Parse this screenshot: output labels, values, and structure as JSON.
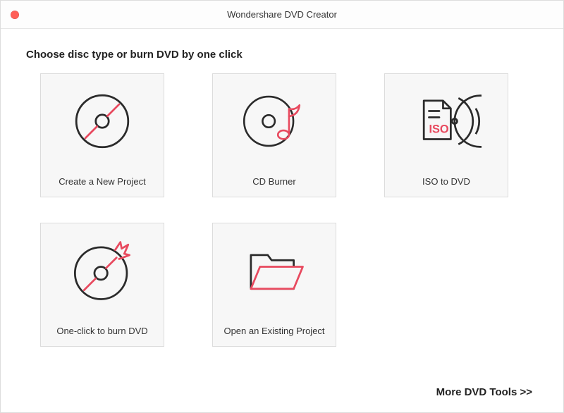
{
  "window": {
    "title": "Wondershare DVD Creator"
  },
  "heading": "Choose disc type or burn DVD by one click",
  "cards": {
    "new_project": "Create a New Project",
    "cd_burner": "CD Burner",
    "iso_to_dvd": "ISO to DVD",
    "one_click_burn": "One-click to burn DVD",
    "open_existing": "Open an Existing Project"
  },
  "footer": {
    "more_tools": "More DVD Tools >>"
  },
  "colors": {
    "accent": "#e84a5f",
    "stroke": "#2b2b2b"
  }
}
